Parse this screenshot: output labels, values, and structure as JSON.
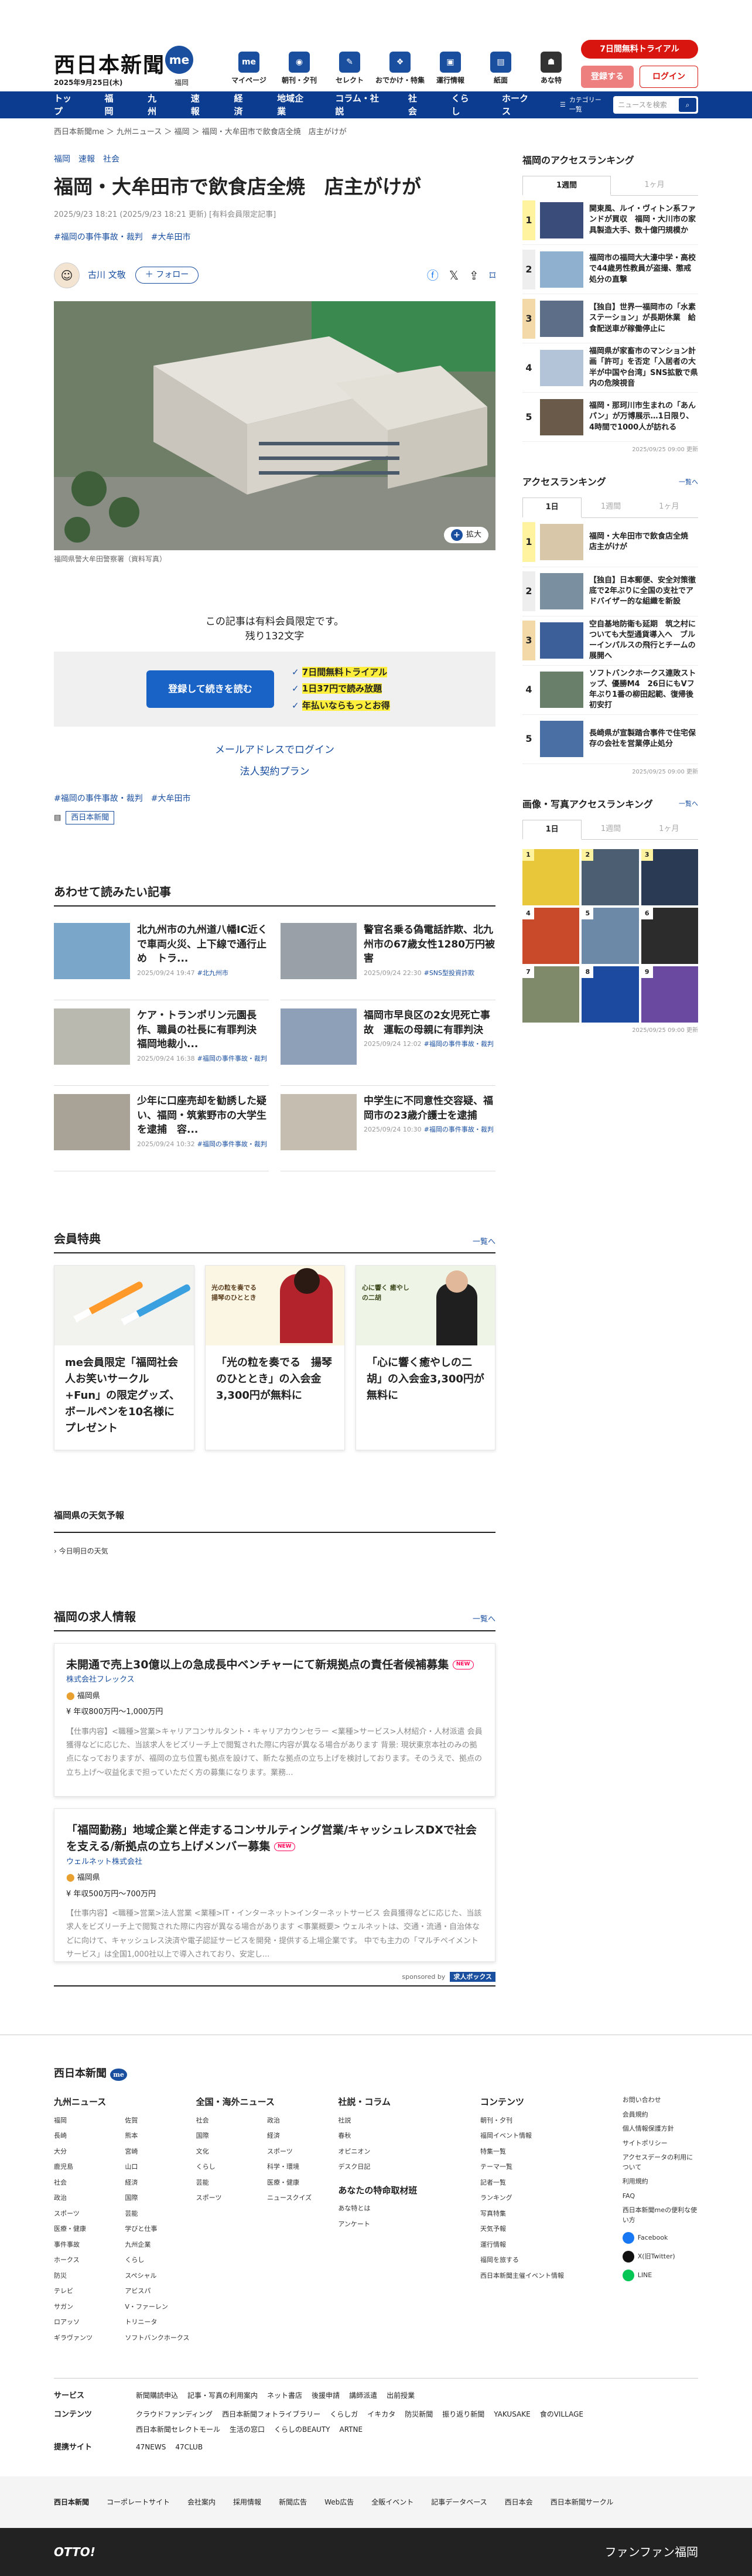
{
  "header": {
    "logo": "西日本新聞",
    "logo_badge": "me",
    "date": "2025年9月25日(木)",
    "region": "福岡",
    "nav": [
      {
        "label": "マイページ",
        "icon": "me-icon",
        "color": "#1a4fa0"
      },
      {
        "label": "朝刊・夕刊",
        "icon": "newspaper-icon",
        "color": "#1a4fa0"
      },
      {
        "label": "セレクト",
        "icon": "select-icon",
        "color": "#1a4fa0"
      },
      {
        "label": "おでかけ・特集",
        "icon": "footprint-icon",
        "color": "#1a4fa0"
      },
      {
        "label": "運行情報",
        "icon": "bus-icon",
        "color": "#1a4fa0"
      },
      {
        "label": "紙面",
        "icon": "paper-icon",
        "color": "#1a4fa0"
      },
      {
        "label": "あな特",
        "icon": "owl-icon",
        "color": "#333333"
      }
    ],
    "trial": "7日間無料トライアル",
    "register": "登録する",
    "login": "ログイン"
  },
  "gnav": {
    "items": [
      "トップ",
      "福岡",
      "九州",
      "速報",
      "経済",
      "地域企業",
      "コラム・社説",
      "社会",
      "くらし",
      "ホークス"
    ],
    "category": "カテゴリー一覧",
    "search_placeholder": "ニュースを検索"
  },
  "breadcrumb": "西日本新聞me ＞ 九州ニュース ＞ 福岡 ＞ 福岡・大牟田市で飲食店全焼　店主がけが",
  "article": {
    "tags": [
      "福岡",
      "速報",
      "社会"
    ],
    "title": "福岡・大牟田市で飲食店全焼　店主がけが",
    "meta": "2025/9/23 18:21 (2025/9/23 18:21 更新) [有料会員限定記事]",
    "meta_tags": "#福岡の事件事故・裁判　#大牟田市",
    "author": "古川 文敬",
    "follow": "＋ フォロー",
    "zoom": "拡大",
    "caption": "福岡県警大牟田警察署（資料写真）",
    "paywall_text": "この記事は有料会員限定です。",
    "remaining": "残り132文字",
    "read_btn": "登録して続きを読む",
    "benefits": [
      "7日間無料トライアル",
      "1日37円で読み放題",
      "年払いならもっとお得"
    ],
    "mail_login": "メールアドレスでログイン",
    "corp": "法人契約プラン",
    "bottom_tags": "#福岡の事件事故・裁判　#大牟田市",
    "publisher": "西日本新聞"
  },
  "rec": {
    "heading": "あわせて読みたい記事",
    "items": [
      {
        "title": "北九州市の九州道八幡IC近くで車両火災、上下線で通行止め　トラ...",
        "date": "2025/09/24 19:47",
        "tag": "#北九州市"
      },
      {
        "title": "警官名乗る偽電話詐欺、北九州市の67歳女性1280万円被害",
        "date": "2025/09/24 22:30",
        "tag": "#SNS型投資詐欺"
      },
      {
        "title": "ケア・トランポリン元園長作、職員の社長に有罪判決　福岡地裁小...",
        "date": "2025/09/24 16:38",
        "tag": "#福岡の事件事故・裁判"
      },
      {
        "title": "福岡市早良区の2女児死亡事故　運転の母親に有罪判決",
        "date": "2025/09/24 12:02",
        "tag": "#福岡の事件事故・裁判"
      },
      {
        "title": "少年に口座売却を勧誘した疑い、福岡・筑紫野市の大学生を逮捕　容...",
        "date": "2025/09/24 10:32",
        "tag": "#福岡の事件事故・裁判"
      },
      {
        "title": "中学生に不同意性交容疑、福岡市の23歳介護士を逮捕",
        "date": "2025/09/24 10:30",
        "tag": "#福岡の事件事故・裁判"
      }
    ]
  },
  "perks": {
    "heading": "会員特典",
    "more": "一覧へ",
    "items": [
      {
        "text": "me会員限定「福岡社会人お笑いサークル+Fun」の限定グッズ、ボールペンを10名様にプレゼント"
      },
      {
        "text": "「光の粒を奏でる　揚琴のひととき」の入会金3,300円が無料に",
        "img_label": "光の粒を奏でる 揚琴のひととき"
      },
      {
        "text": "「心に響く癒やしの二胡」の入会金3,300円が無料に",
        "img_label": "心に響く 癒やしの二胡"
      }
    ]
  },
  "weather": {
    "heading": "福岡県の天気予報",
    "sub": "今日明日の天気"
  },
  "jobs": {
    "heading": "福岡の求人情報",
    "more": "一覧へ",
    "new": "NEW",
    "items": [
      {
        "title": "未開通で売上30億以上の急成長中ベンチャーにて新規拠点の責任者候補募集",
        "company": "株式会社フレックス",
        "loc": "福岡県",
        "salary": "年収800万円〜1,000万円",
        "desc": "【仕事内容】<職種>営業>キャリアコンサルタント・キャリアカウンセラー <業種>サービス>人材紹介・人材派遣 会員獲得などに応じた、当該求人をビズリーチ上で閲覧された際に内容が異なる場合があります 背景: 現状東京本社のみの拠点になっておりますが、福岡の立ち位置も拠点を設けて、新たな拠点の立ち上げを検討しております。そのうえで、拠点の立ち上げ〜収益化まで担っていただく方の募集になります。業務..."
      },
      {
        "title": "「福岡勤務」地域企業と伴走するコンサルティング営業/キャッシュレスDXで社会を支える/新拠点の立ち上げメンバー募集",
        "company": "ウェルネット株式会社",
        "loc": "福岡県",
        "salary": "年収500万円〜700万円",
        "desc": "【仕事内容】<職種>営業>法人営業 <業種>IT・インターネット>インターネットサービス 会員獲得などに応じた、当該求人をビズリーチ上で閲覧された際に内容が異なる場合があります <事業概要> ウェルネットは、交通・流通・自治体などに向けて、キャッシュレス決済や電子認証サービスを開発・提供する上場企業です。 中でも主力の「マルチペイメントサービス」は全国1,000社以上で導入されており、安定し..."
      }
    ],
    "sponsor": "sponsored by",
    "sponsor_name": "求人ボックス"
  },
  "side": {
    "fk_heading": "福岡のアクセスランキング",
    "fk_tabs": [
      "1週間",
      "1ヶ月"
    ],
    "fk_items": [
      "関東風、ルイ・ヴィトン系ファンドが買収　福岡・大川市の家具製造大手、数十億円規模か",
      "福岡市の福岡大大濠中学・高校で44歳男性教員が盗撮、懲戒処分の直撃",
      "【独自】世界一福岡市の「水素ステーション」が長期休業　給食配送車が稼働停止に",
      "福岡県が家畜市のマンション計画「許可」を否定「入居者の大半が中国や台湾」SNS拡散で県内の危険視音",
      "福岡・那珂川市生まれの「あん パン」が万博展示…1日限り、4時間で1000人が訪れる"
    ],
    "fk_stamp": "2025/09/25 09:00 更新",
    "ac_heading": "アクセスランキング",
    "ac_more": "一覧へ",
    "ac_tabs": [
      "1日",
      "1週間",
      "1ヶ月"
    ],
    "ac_items": [
      "福岡・大牟田市で飲食店全焼　店主がけが",
      "【独自】日本郵便、安全対策徹底で2年ぶりに全国の支社でアドバイザー的な組織を新設",
      "空自基地防衛も延期　筑之村についても大型通貨導入へ　ブルーインパルスの飛行とチームの展開へ",
      "ソフトバンクホークス連敗ストップ、優勝M4　26日にもVフ年ぶり1番の柳田起範、復帰後初安打",
      "長崎県が宣製踏合事件で住宅保存の会社を営業停止処分"
    ],
    "ac_stamp": "2025/09/25 09:00 更新",
    "ph_heading": "画像・写真アクセスランキング",
    "ph_more": "一覧へ",
    "ph_tabs": [
      "1日",
      "1週間",
      "1ヶ月"
    ],
    "ph_stamp": "2025/09/25 09:00 更新"
  },
  "footer": {
    "logo": "西日本新聞",
    "cols": [
      {
        "h": "九州ニュース",
        "items": [
          "福岡",
          "佐賀",
          "長崎",
          "熊本",
          "大分",
          "宮崎",
          "鹿児島",
          "山口",
          "社会",
          "経済",
          "政治",
          "国際",
          "スポーツ",
          "芸能",
          "医療・健康",
          "学びと仕事",
          "事件事故",
          "九州企業",
          "ホークス",
          "くらし",
          "防災",
          "スペシャル",
          "テレビ",
          "アビスパ",
          "サガン",
          "V・ファーレン",
          "ロアッソ",
          "トリニータ",
          "ギラヴァンツ",
          "ソフトバンクホークス"
        ]
      },
      {
        "h": "全国・海外ニュース",
        "items": [
          "社会",
          "政治",
          "国際",
          "経済",
          "文化",
          "スポーツ",
          "くらし",
          "科学・環境",
          "芸能",
          "医療・健康",
          "スポーツ",
          "ニュースクイズ"
        ]
      },
      {
        "h": "社説・コラム",
        "items": [
          "社説",
          "春秋",
          "オピニオン",
          "デスク日記"
        ],
        "h2": "あなたの特命取材班",
        "items2": [
          "あな特とは",
          "アンケート"
        ]
      },
      {
        "h": "コンテンツ",
        "items": [
          "朝刊・夕刊",
          "福岡イベント情報",
          "特集一覧",
          "テーマ一覧",
          "記者一覧",
          "ランキング",
          "写真特集",
          "天気予報",
          "運行情報",
          "福岡を旅する",
          "西日本新聞主催イベント情報"
        ]
      }
    ],
    "small": [
      "お問い合わせ",
      "会員規約",
      "個人情報保護方針",
      "サイトポリシー",
      "アクセスデータの利用について",
      "利用規約",
      "FAQ",
      "西日本新聞meの便利な使い方"
    ],
    "sns": [
      {
        "label": "Facebook",
        "color": "#1877f2"
      },
      {
        "label": "X(旧Twitter)",
        "color": "#111111"
      },
      {
        "label": "LINE",
        "color": "#06c755"
      }
    ],
    "rows": [
      {
        "h": "サービス",
        "items": [
          "新聞購読申込",
          "記事・写真の利用案内",
          "ネット書店",
          "後援申請",
          "講師派遣",
          "出前授業"
        ]
      },
      {
        "h": "コンテンツ",
        "items": [
          "クラウドファンディング",
          "西日本新聞フォトライブラリー",
          "くらしガ",
          "イキカタ",
          "防災新聞",
          "振り返り新聞",
          "YAKUSAKE",
          "食のVILLAGE",
          "西日本新聞セレクトモール",
          "生活の窓口",
          "くらしのBEAUTY",
          "ARTNE"
        ]
      },
      {
        "h": "提携サイト",
        "items": [
          "47NEWS",
          "47CLUB"
        ]
      }
    ],
    "bar": [
      "コーポレートサイト",
      "会社案内",
      "採用情報",
      "新聞広告",
      "Web広告",
      "全販イベント",
      "記事データベース",
      "西日本会",
      "西日本新聞サークル"
    ],
    "bar_logo": "西日本新聞",
    "copy_left": "OTTO!",
    "copy_right": "ファンファン福岡"
  }
}
